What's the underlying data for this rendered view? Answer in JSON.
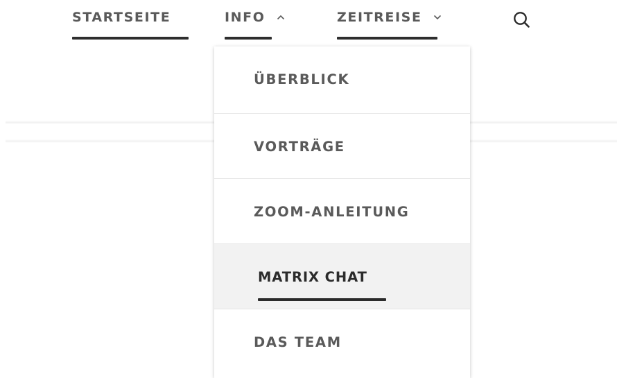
{
  "nav": {
    "items": [
      {
        "label": "STARTSEITE"
      },
      {
        "label": "INFO",
        "chevron": "chevron-up-icon"
      },
      {
        "label": "ZEITREISE",
        "chevron": "chevron-down-icon"
      }
    ],
    "search_icon": "search-icon"
  },
  "dropdown": {
    "items": [
      {
        "label": "ÜBERBLICK"
      },
      {
        "label": "VORTRÄGE"
      },
      {
        "label": "ZOOM-ANLEITUNG"
      },
      {
        "label": "MATRIX CHAT"
      },
      {
        "label": "DAS TEAM"
      }
    ]
  },
  "colors": {
    "text": "#5a5a5a",
    "active_text": "#2b2b2b",
    "underline": "#2e2e2e",
    "active_bg": "#f2f2f2"
  }
}
